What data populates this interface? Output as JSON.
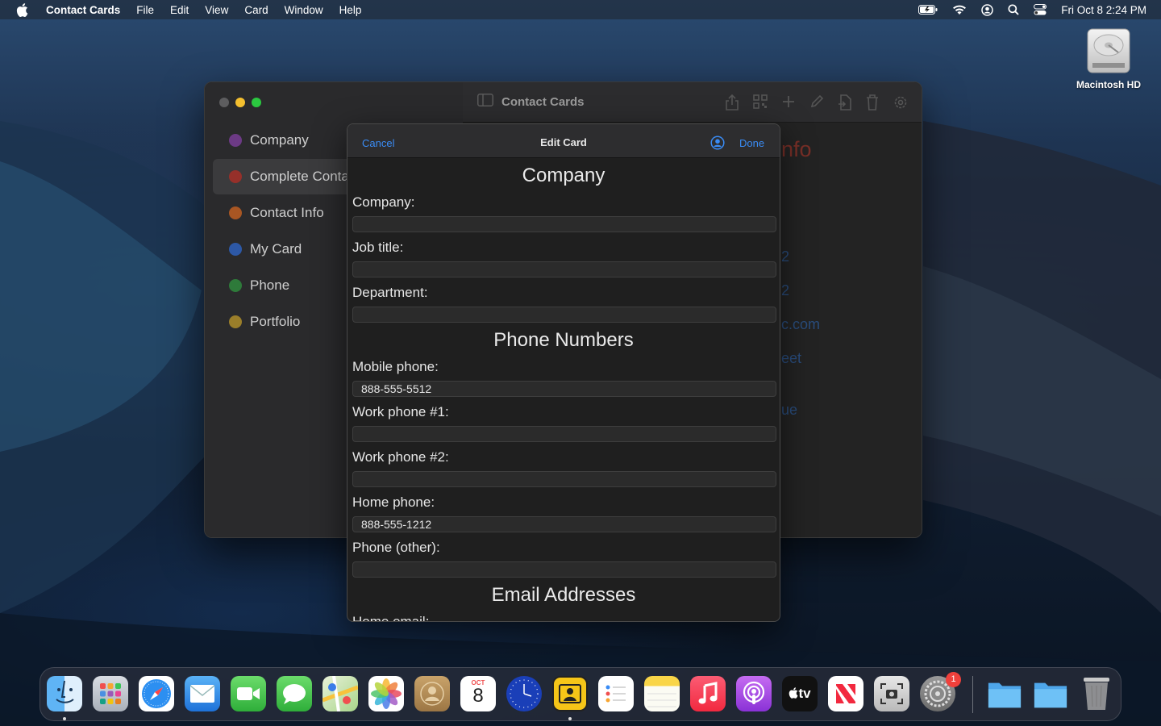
{
  "menubar": {
    "app_name": "Contact Cards",
    "menus": [
      "File",
      "Edit",
      "View",
      "Card",
      "Window",
      "Help"
    ],
    "clock": "Fri Oct 8  2:24 PM"
  },
  "desktop": {
    "disk_label": "Macintosh HD"
  },
  "window": {
    "title": "Contact Cards",
    "sidebar": [
      {
        "label": "Company",
        "color": "#8e44ad"
      },
      {
        "label": "Complete Conta",
        "color": "#c0392b"
      },
      {
        "label": "Contact Info",
        "color": "#d35400"
      },
      {
        "label": "My Card",
        "color": "#2c6fd1"
      },
      {
        "label": "Phone",
        "color": "#2e9e44"
      },
      {
        "label": "Portfolio",
        "color": "#c9a227"
      }
    ],
    "background_fragments": {
      "title": "nfo",
      "line1": "2",
      "line2": "2",
      "line3": "c.com",
      "line4": "eet",
      "line5": "ue"
    }
  },
  "sheet": {
    "cancel": "Cancel",
    "title": "Edit Card",
    "done": "Done",
    "sections": {
      "company": "Company",
      "phones": "Phone Numbers",
      "emails": "Email Addresses"
    },
    "fields": {
      "company": {
        "label": "Company:",
        "value": ""
      },
      "job_title": {
        "label": "Job title:",
        "value": ""
      },
      "department": {
        "label": "Department:",
        "value": ""
      },
      "mobile": {
        "label": "Mobile phone:",
        "value": "888-555-5512"
      },
      "work1": {
        "label": "Work phone #1:",
        "value": ""
      },
      "work2": {
        "label": "Work phone #2:",
        "value": ""
      },
      "home": {
        "label": "Home phone:",
        "value": "888-555-1212"
      },
      "other": {
        "label": "Phone (other):",
        "value": ""
      },
      "home_email": {
        "label": "Home email:"
      }
    }
  },
  "dock": {
    "calendar_month": "OCT",
    "calendar_day": "8",
    "tv_label": "tv",
    "settings_badge": "1"
  }
}
